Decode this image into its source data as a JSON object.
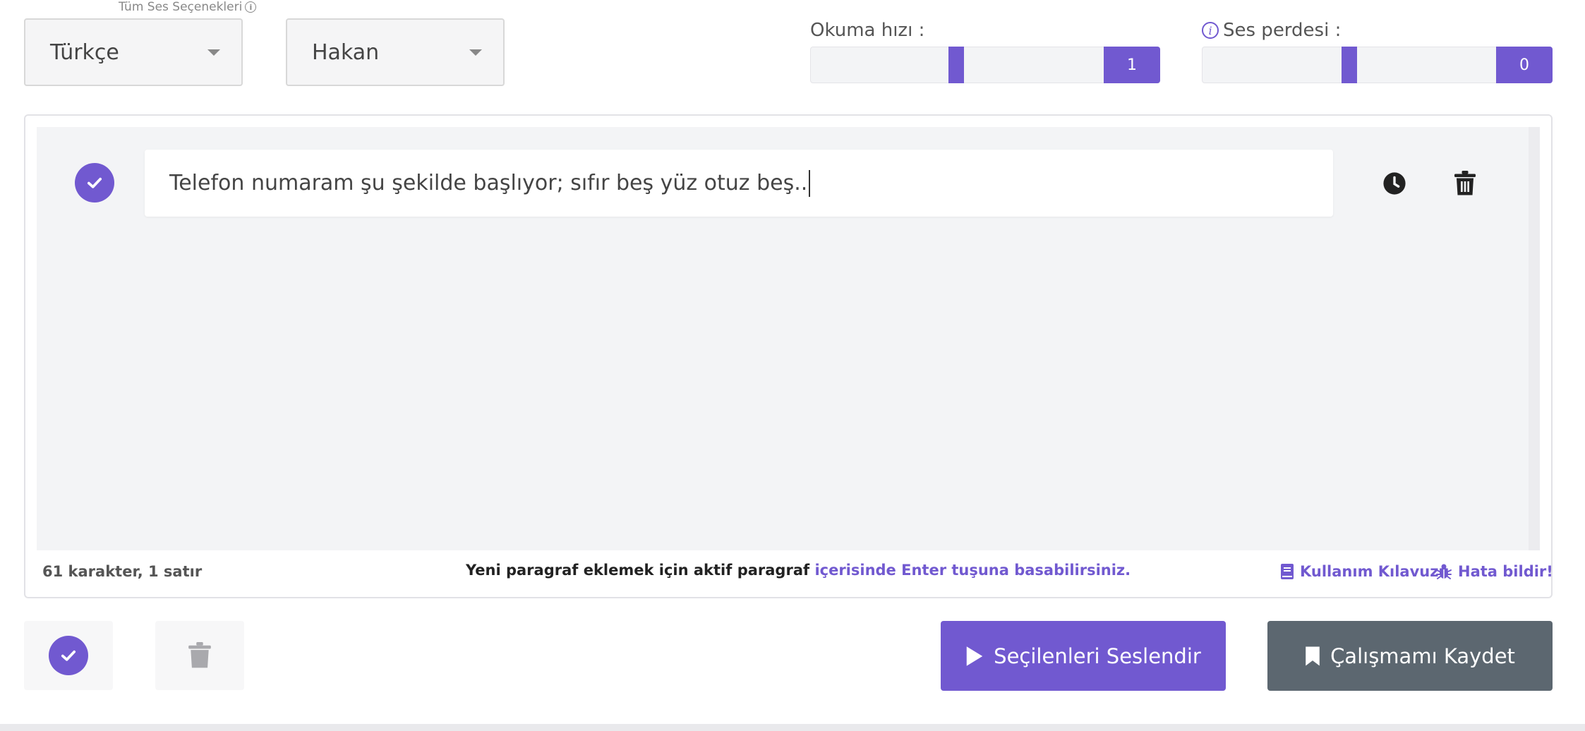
{
  "voice_options": {
    "label": "Tüm Ses Seçenekleri"
  },
  "language_select": {
    "value": "Türkçe"
  },
  "voice_select": {
    "value": "Hakan"
  },
  "speed": {
    "label": "Okuma hızı :",
    "value": "1",
    "level": 0.55
  },
  "pitch": {
    "label": "Ses perdesi :",
    "value": "0",
    "level": 0.5
  },
  "paragraphs": [
    {
      "text": "Telefon numaram şu şekilde başlıyor; sıfır beş yüz otuz beş..",
      "selected": true
    }
  ],
  "footer": {
    "stats": "61 karakter, 1 satır",
    "hint_dark": "Yeni paragraf eklemek için aktif paragraf ",
    "hint_purple": "içerisinde Enter tuşuna basabilirsiniz.",
    "guide_link": "Kullanım Kılavuzu",
    "report_link": "Hata bildir!"
  },
  "actions": {
    "speak_label": "Seçilenleri Seslendir",
    "save_label": "Çalışmamı Kaydet"
  },
  "colors": {
    "accent": "#7159d0",
    "dark_button": "#5c6770"
  },
  "icons": [
    "check-icon",
    "clock-icon",
    "trash-icon",
    "info-icon",
    "book-icon",
    "bug-icon",
    "play-icon",
    "bookmark-icon",
    "caret-down-icon"
  ]
}
